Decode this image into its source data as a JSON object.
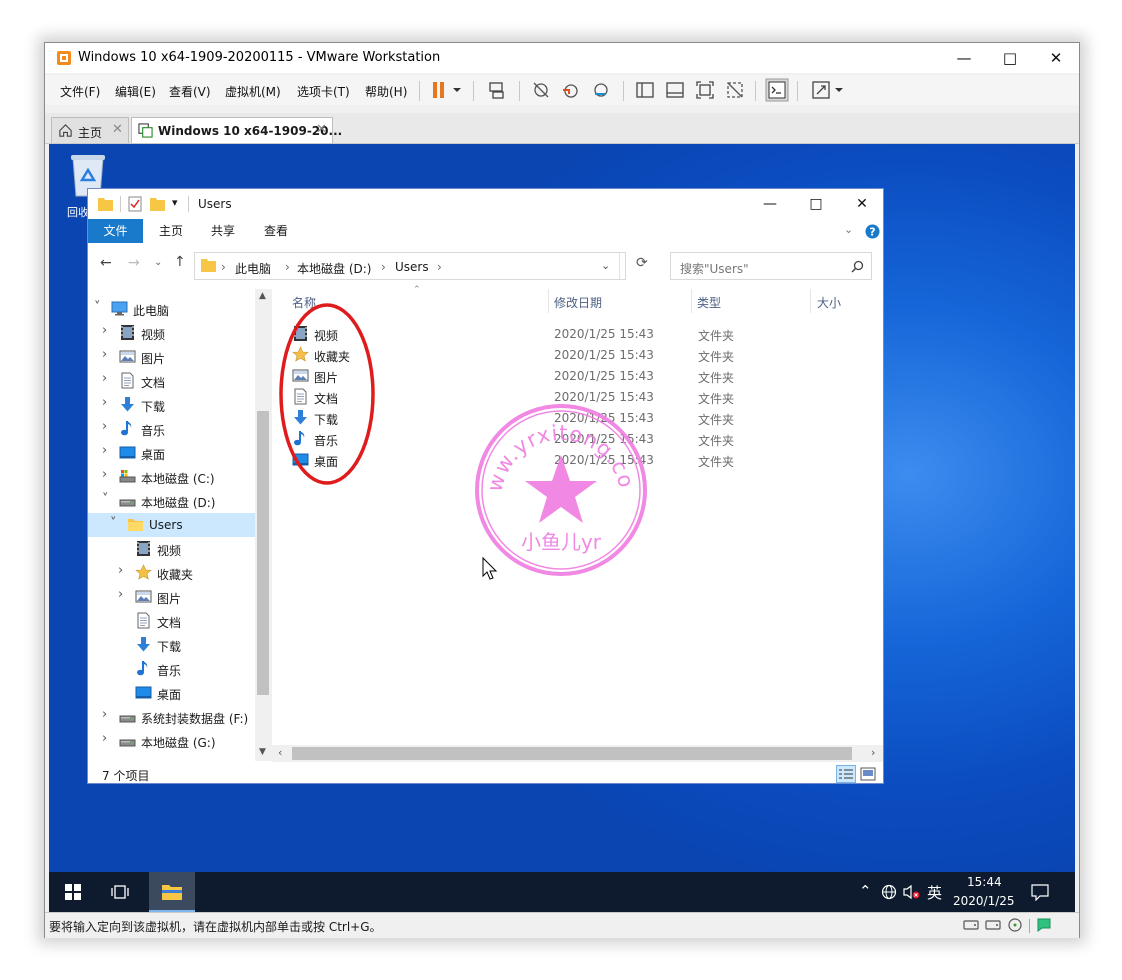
{
  "vmware": {
    "title": "Windows 10 x64-1909-20200115 - VMware Workstation",
    "menu": [
      "文件(F)",
      "编辑(E)",
      "查看(V)",
      "虚拟机(M)",
      "选项卡(T)",
      "帮助(H)"
    ],
    "tabs": [
      {
        "label": "主页",
        "icon": "home-icon"
      },
      {
        "label": "Windows 10 x64-1909-20...",
        "icon": "vm-icon"
      }
    ],
    "status_text": "要将输入定向到该虚拟机，请在虚拟机内部单击或按 Ctrl+G。",
    "accent_pause": "#e8761c"
  },
  "desktop": {
    "recycle_label": "回收",
    "taskbar": {
      "clock_time": "15:44",
      "clock_date": "2020/1/25",
      "ime": "英"
    }
  },
  "explorer": {
    "title": "Users",
    "ribbon_tabs": [
      "文件",
      "主页",
      "共享",
      "查看"
    ],
    "breadcrumb": [
      "此电脑",
      "本地磁盘 (D:)",
      "Users"
    ],
    "search_placeholder": "搜索\"Users\"",
    "columns": [
      "名称",
      "修改日期",
      "类型",
      "大小"
    ],
    "rows": [
      {
        "name": "视频",
        "date": "2020/1/25 15:43",
        "type": "文件夹",
        "icon": "video-folder-icon"
      },
      {
        "name": "收藏夹",
        "date": "2020/1/25 15:43",
        "type": "文件夹",
        "icon": "favorites-folder-icon"
      },
      {
        "name": "图片",
        "date": "2020/1/25 15:43",
        "type": "文件夹",
        "icon": "pictures-folder-icon"
      },
      {
        "name": "文档",
        "date": "2020/1/25 15:43",
        "type": "文件夹",
        "icon": "documents-folder-icon"
      },
      {
        "name": "下载",
        "date": "2020/1/25 15:43",
        "type": "文件夹",
        "icon": "downloads-folder-icon"
      },
      {
        "name": "音乐",
        "date": "2020/1/25 15:43",
        "type": "文件夹",
        "icon": "music-folder-icon"
      },
      {
        "name": "桌面",
        "date": "2020/1/25 15:43",
        "type": "文件夹",
        "icon": "desktop-folder-icon"
      }
    ],
    "nav": [
      {
        "label": "此电脑",
        "icon": "pc-icon",
        "expanded": true
      },
      {
        "label": "视频",
        "icon": "video-folder-icon"
      },
      {
        "label": "图片",
        "icon": "pictures-folder-icon"
      },
      {
        "label": "文档",
        "icon": "documents-folder-icon"
      },
      {
        "label": "下载",
        "icon": "downloads-folder-icon"
      },
      {
        "label": "音乐",
        "icon": "music-folder-icon"
      },
      {
        "label": "桌面",
        "icon": "desktop-folder-icon"
      },
      {
        "label": "本地磁盘 (C:)",
        "icon": "system-drive-icon"
      },
      {
        "label": "本地磁盘 (D:)",
        "icon": "drive-icon",
        "expanded": true
      },
      {
        "label": "Users",
        "icon": "folder-icon",
        "expanded": true,
        "selected": true
      },
      {
        "label": "视频",
        "icon": "video-folder-icon"
      },
      {
        "label": "收藏夹",
        "icon": "favorites-folder-icon"
      },
      {
        "label": "图片",
        "icon": "pictures-folder-icon"
      },
      {
        "label": "文档",
        "icon": "documents-folder-icon"
      },
      {
        "label": "下载",
        "icon": "downloads-folder-icon"
      },
      {
        "label": "音乐",
        "icon": "music-folder-icon"
      },
      {
        "label": "桌面",
        "icon": "desktop-folder-icon"
      },
      {
        "label": "系统封装数据盘 (F:)",
        "icon": "drive-icon"
      },
      {
        "label": "本地磁盘 (G:)",
        "icon": "drive-icon"
      }
    ],
    "status_count": "7 个项目"
  },
  "watermark": {
    "url_text": "www.yrxitong.com",
    "name_text": "小鱼儿yr",
    "color": "#f07ce0"
  },
  "annotation_color": "#e01b1b"
}
